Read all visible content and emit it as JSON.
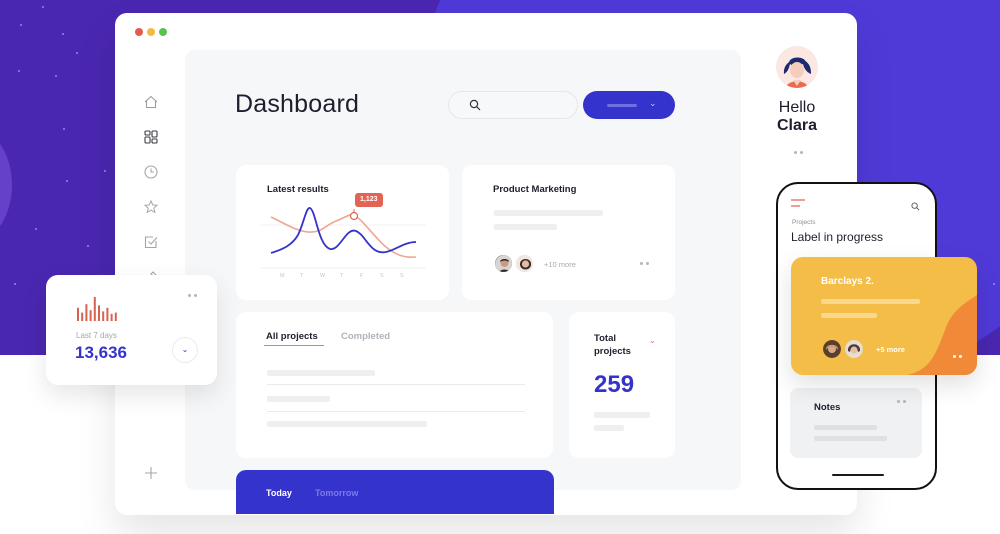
{
  "window": {
    "controls": [
      "close",
      "minimize",
      "maximize"
    ]
  },
  "sidebar": {
    "items": [
      {
        "icon": "home-icon"
      },
      {
        "icon": "grid-icon",
        "active": true
      },
      {
        "icon": "clock-icon"
      },
      {
        "icon": "star-icon"
      },
      {
        "icon": "checkbox-icon"
      },
      {
        "icon": "pin-icon"
      }
    ],
    "add_icon": "plus-icon"
  },
  "header": {
    "title": "Dashboard",
    "search_placeholder": ""
  },
  "latest_results": {
    "title": "Latest results",
    "tooltip_value": "1,123",
    "days": [
      "M",
      "T",
      "W",
      "T",
      "F",
      "S",
      "S"
    ],
    "colors": {
      "primary": "#3434cc",
      "secondary": "#f0a595"
    }
  },
  "product_marketing": {
    "title": "Product Marketing",
    "members_more": "+10 more"
  },
  "projects": {
    "tabs": [
      {
        "label": "All projects",
        "active": true
      },
      {
        "label": "Completed",
        "active": false
      }
    ]
  },
  "total_projects": {
    "label": "Total projects",
    "value": "259"
  },
  "schedule": {
    "tabs": [
      {
        "label": "Today",
        "active": true
      },
      {
        "label": "Tomorrow",
        "active": false
      }
    ]
  },
  "profile": {
    "greeting": "Hello",
    "name": "Clara"
  },
  "stat_card": {
    "label": "Last 7 days",
    "value": "13,636"
  },
  "phone": {
    "section": "Projects",
    "title": "Label in progress",
    "project_card": {
      "title": "Barclays 2.",
      "members_more": "+5 more"
    },
    "notes": {
      "title": "Notes"
    }
  },
  "colors": {
    "accent": "#3434cc",
    "background": "#4a27b0",
    "highlight": "#f3bd48",
    "danger": "#e36454"
  }
}
